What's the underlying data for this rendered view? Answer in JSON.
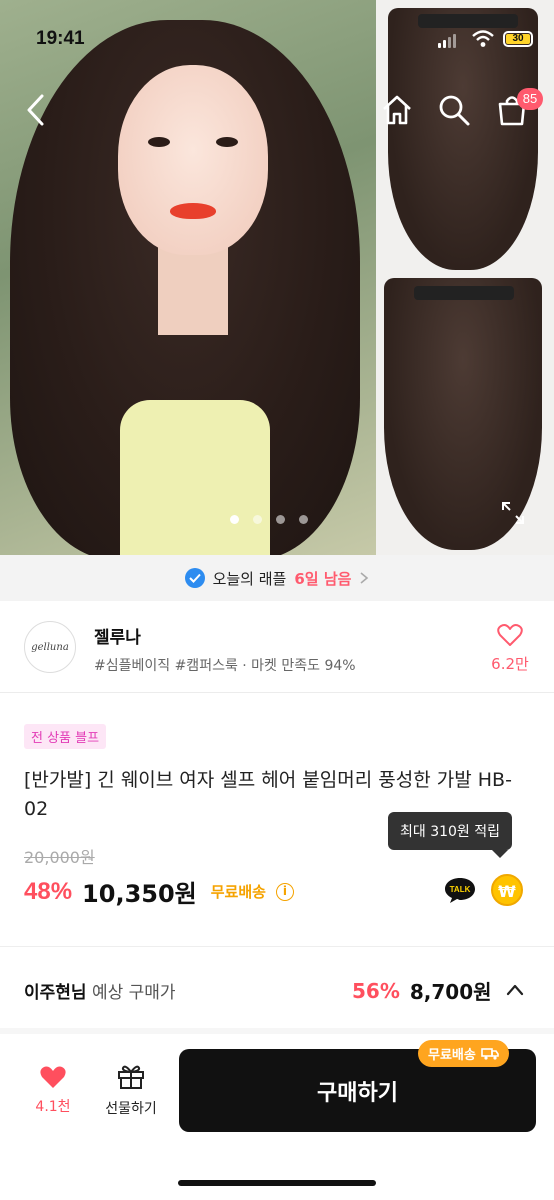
{
  "status_bar": {
    "time": "19:41",
    "battery": "30"
  },
  "nav": {
    "cart_count": "85"
  },
  "gallery": {
    "dots": 4,
    "active_dot": 0
  },
  "raffle": {
    "prefix": "오늘의 래플",
    "days": "6일 남음"
  },
  "shop": {
    "logo_text": "gelluna",
    "name": "젤루나",
    "tags": "#심플베이직 #캠퍼스룩 · 마켓 만족도 94%",
    "likes": "6.2만"
  },
  "product": {
    "badge": "전 상품 블프",
    "title": "[반가발] 긴 웨이브 여자 셀프 헤어 붙임머리 풍성한 가발 HB-02",
    "reward_tooltip": "최대 310원 적립",
    "original_price": "20,000원",
    "discount": "48%",
    "price": "10,350원",
    "free_shipping": "무료배송",
    "talk_label": "TALK",
    "coin_label": "₩"
  },
  "expected": {
    "user": "이주현님",
    "label": "예상 구매가",
    "discount": "56%",
    "price": "8,700원"
  },
  "bottom_bar": {
    "like_count": "4.1천",
    "gift_label": "선물하기",
    "buy_label": "구매하기",
    "ship_pill": "무료배송"
  },
  "colors": {
    "accent": "#ff4f5e",
    "shipping": "#f5a300",
    "buy_button": "#111111"
  }
}
